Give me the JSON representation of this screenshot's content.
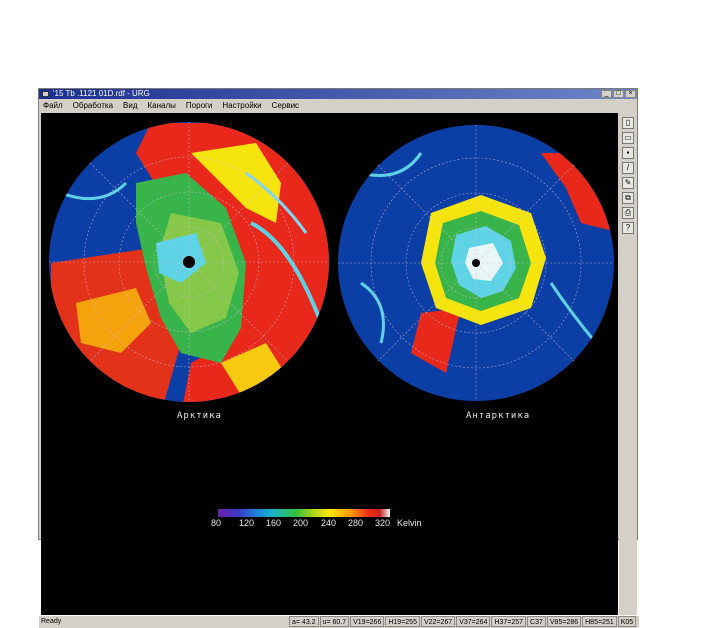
{
  "window": {
    "title": "'15 Tb .1121 01D.rdf - URG",
    "controls": [
      "_",
      "□",
      "×"
    ]
  },
  "menu": {
    "items": [
      "Файл",
      "Обработка",
      "Вид",
      "Каналы",
      "Пороги",
      "Настройки",
      "Сервис"
    ]
  },
  "images": {
    "left_label": "Арктика",
    "right_label": "Антарктика"
  },
  "colorbar": {
    "ticks": [
      "80",
      "120",
      "160",
      "200",
      "240",
      "280",
      "320"
    ],
    "unit": "Kelvin"
  },
  "toolbar": {
    "icons": [
      "new-file-icon",
      "open-icon",
      "save-icon",
      "draw-line-icon",
      "pencil-icon",
      "copy-icon",
      "print-icon",
      "help-icon"
    ]
  },
  "status": {
    "ready": "Ready",
    "cells": [
      "a= 43.2",
      "u= 60.7",
      "V19=266",
      "H19=255",
      "V22=267",
      "V37=264",
      "H37=257",
      "C37",
      "V85=286",
      "H85=251",
      "K05"
    ]
  }
}
